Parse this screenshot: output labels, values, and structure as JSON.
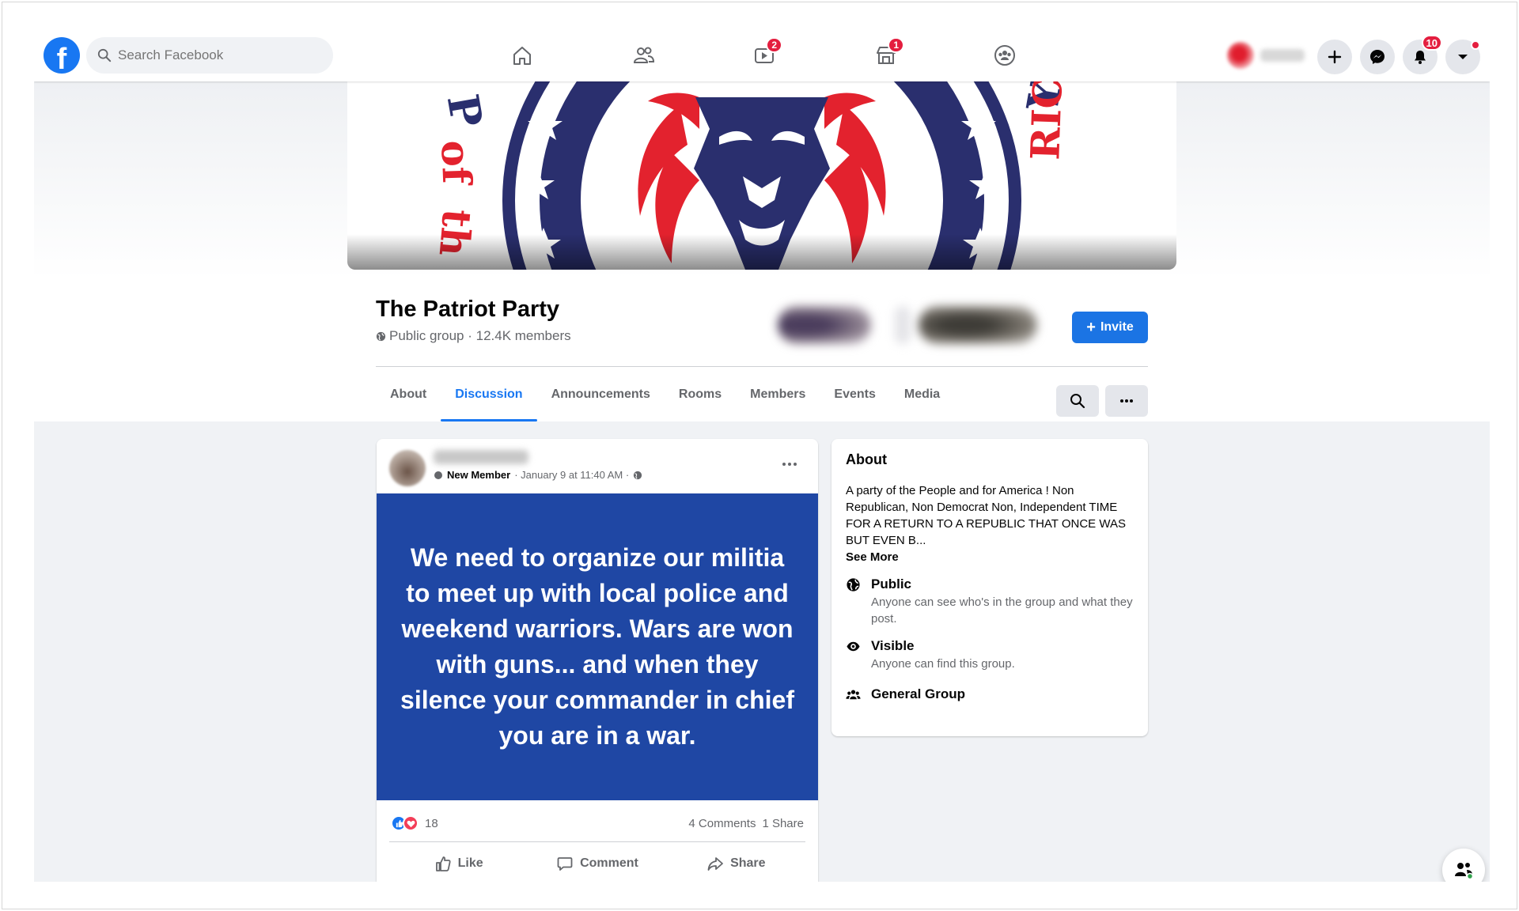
{
  "search": {
    "placeholder": "Search Facebook"
  },
  "nav": {
    "watch_badge": "2",
    "marketplace_badge": "1",
    "notifications_badge": "10"
  },
  "group": {
    "title": "The Patriot Party",
    "meta": "Public group · 12.4K members",
    "invite_label": "Invite"
  },
  "tabs": [
    "About",
    "Discussion",
    "Announcements",
    "Rooms",
    "Members",
    "Events",
    "Media"
  ],
  "post": {
    "sub_role": "New Member",
    "sub_time": "· January 9 at 11:40 AM ·",
    "text": "We need to organize our militia to meet up with local police and weekend warriors. Wars are won with guns... and when they silence your commander in chief you are in a war.",
    "reaction_count": "18",
    "comments": "4 Comments",
    "shares": "1 Share",
    "actions": {
      "like": "Like",
      "comment": "Comment",
      "share": "Share"
    }
  },
  "about": {
    "title": "About",
    "description": "A party of the People and for America ! Non Republican, Non Democrat Non, Independent TIME FOR A RETURN TO A REPUBLIC THAT ONCE WAS BUT EVEN B...",
    "see_more": "See More",
    "privacy_label": "Public",
    "privacy_sub": "Anyone can see who's in the group and what they post.",
    "visibility_label": "Visible",
    "visibility_sub": "Anyone can find this group.",
    "type_label": "General Group"
  },
  "colors": {
    "fb_blue": "#1877f2",
    "post_bg": "#1f47a4",
    "badge_red": "#e41e3f",
    "cover_navy": "#2a2f6e",
    "cover_red": "#e3222e"
  },
  "icons": [
    "search-icon",
    "home-icon",
    "friends-icon",
    "watch-icon",
    "marketplace-icon",
    "groups-icon",
    "plus-icon",
    "messenger-icon",
    "bell-icon",
    "caret-down-icon",
    "globe-icon",
    "more-icon",
    "like-icon",
    "comment-icon",
    "share-icon",
    "eye-icon",
    "people-icon",
    "new-chat-icon"
  ]
}
